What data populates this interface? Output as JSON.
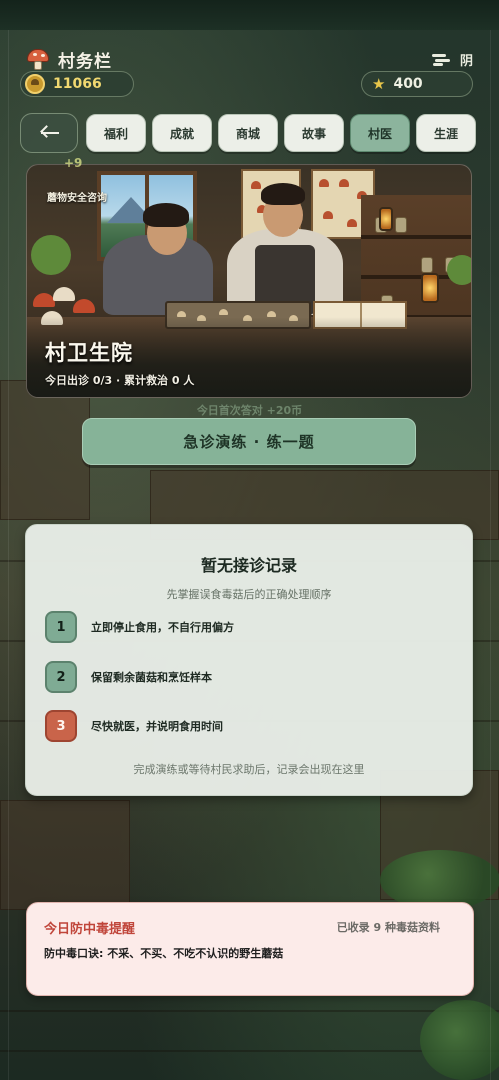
{
  "header": {
    "title": "村务栏",
    "weather_icon": "wind-icon",
    "weather_label": "阴"
  },
  "stats": {
    "coins": "11066",
    "stars": "400"
  },
  "tabs": [
    {
      "label": "福利"
    },
    {
      "label": "成就"
    },
    {
      "label": "商城"
    },
    {
      "label": "故事"
    },
    {
      "label": "村医"
    },
    {
      "label": "生涯"
    }
  ],
  "active_tab": "村医",
  "float_reward": "+9",
  "hero": {
    "tag": "蘑物安全咨询",
    "title": "村卫生院",
    "subtitle": "今日出诊 0/3 · 累计救治 0 人"
  },
  "first_bonus": "今日首次答对 +20币",
  "cta_label": "急诊演练 · 练一题",
  "record": {
    "title": "暂无接诊记录",
    "hint": "先掌握误食毒菇后的正确处理顺序",
    "steps": [
      {
        "num": "1",
        "text": "立即停止食用，不自行用偏方"
      },
      {
        "num": "2",
        "text": "保留剩余菌菇和烹饪样本"
      },
      {
        "num": "3",
        "text": "尽快就医，并说明食用时间"
      }
    ],
    "footer": "完成演练或等待村民求助后，记录会出现在这里"
  },
  "reminder": {
    "title": "今日防中毒提醒",
    "count": "已收录 9 种毒菇资料",
    "body": "防中毒口诀: 不采、不买、不吃不认识的野生蘑菇"
  },
  "colors": {
    "accent_green": "#86b398",
    "alert_red": "#c9644a",
    "coin_gold": "#f1d870"
  }
}
